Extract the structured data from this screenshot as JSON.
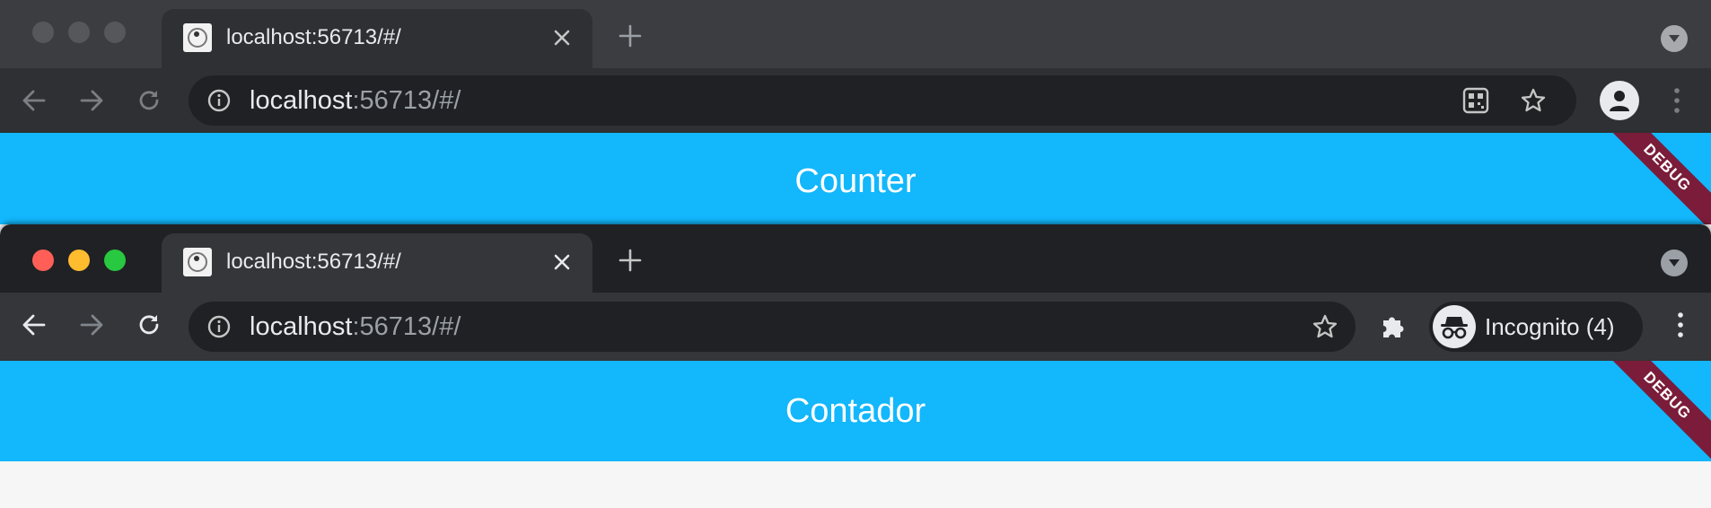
{
  "windows": [
    {
      "tab": {
        "title": "localhost:56713/#/",
        "close": "✕"
      },
      "new_tab": "+",
      "url": {
        "host": "localhost",
        "rest": ":56713/#/"
      },
      "app_title": "Counter",
      "debug_banner": "DEBUG"
    },
    {
      "tab": {
        "title": "localhost:56713/#/",
        "close": "✕"
      },
      "new_tab": "+",
      "url": {
        "host": "localhost",
        "rest": ":56713/#/"
      },
      "incognito_label": "Incognito (4)",
      "app_title": "Contador",
      "debug_banner": "DEBUG"
    }
  ],
  "colors": {
    "app_bar": "#12b7fc",
    "debug_banner": "#7a1c3a",
    "traffic_red": "#ff5f57",
    "traffic_yellow": "#febc2e",
    "traffic_green": "#28c840"
  }
}
